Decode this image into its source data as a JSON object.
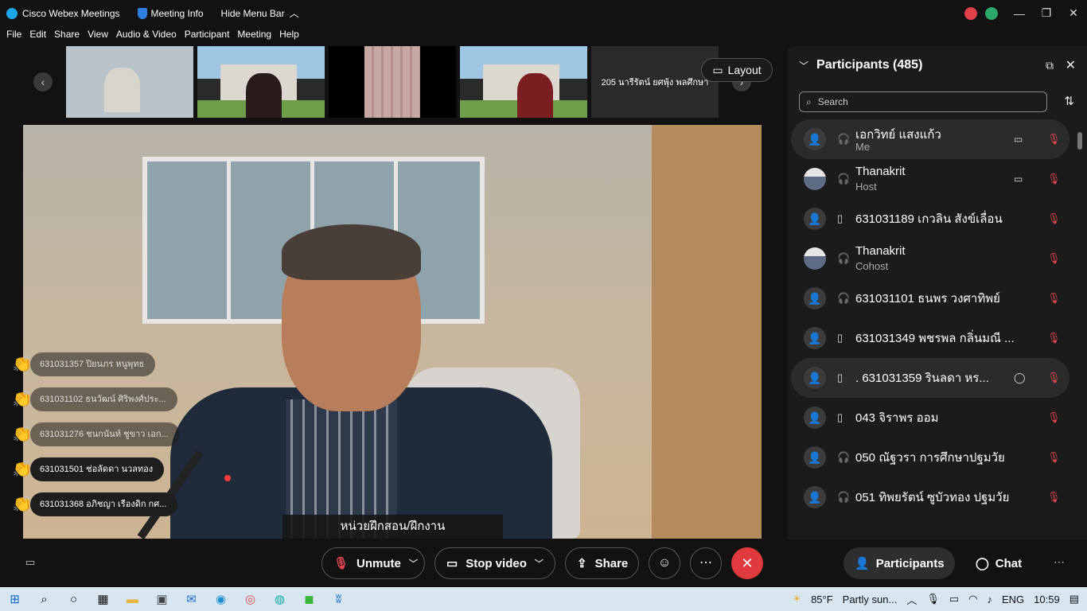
{
  "titlebar": {
    "app_name": "Cisco Webex Meetings",
    "meeting_info": "Meeting Info",
    "hide_menu_bar": "Hide Menu Bar"
  },
  "menu": [
    "File",
    "Edit",
    "Share",
    "View",
    "Audio & Video",
    "Participant",
    "Meeting",
    "Help"
  ],
  "filmstrip": {
    "name_card": "205 นารีรัตน์ ยศพุ้ง พลศึกษา",
    "layout_label": "Layout"
  },
  "main_video": {
    "caption": "หน่วยฝึกสอน/ฝึกงาน"
  },
  "reactions": [
    {
      "name": "631031357 ปิยนภร หนูพุทธ",
      "faded": true
    },
    {
      "name": "631031102 ธนวัฒน์ ศิริพงศ์ประ...",
      "faded": true
    },
    {
      "name": "631031276 ชนกนันท์ ชูขาว เอก...",
      "faded": true
    },
    {
      "name": "631031501 ช่อลัดดา นวลทอง",
      "faded": false
    },
    {
      "name": "631031368 อภิชญา เรืองดิก กศ...",
      "faded": false
    }
  ],
  "panel": {
    "title": "Participants (485)",
    "search_placeholder": "Search",
    "participants": [
      {
        "name": "เอกวิทย์ แสงแก้ว",
        "role": "Me",
        "device": "headset",
        "camera": true,
        "highlight": true
      },
      {
        "name": "Thanakrit",
        "role": "Host",
        "device": "headset",
        "camera": true,
        "highlight": false,
        "photo": true
      },
      {
        "name": "631031189 เกวลิน สังข์เลื่อน",
        "role": "",
        "device": "phone",
        "camera": false,
        "highlight": false
      },
      {
        "name": "Thanakrit",
        "role": "Cohost",
        "device": "headset",
        "camera": false,
        "highlight": false,
        "photo": true
      },
      {
        "name": "631031101 ธนพร วงศาทิพย์",
        "role": "",
        "device": "headset",
        "camera": false,
        "highlight": false
      },
      {
        "name": "631031349 พชรพล กลิ่นมณี ...",
        "role": "",
        "device": "phone",
        "camera": false,
        "highlight": false
      },
      {
        "name": ". 631031359 รินลดา หร...",
        "role": "",
        "device": "phone",
        "camera": false,
        "chat": true,
        "highlight": true
      },
      {
        "name": "043 จิราพร ออม",
        "role": "",
        "device": "phone",
        "camera": false,
        "highlight": false
      },
      {
        "name": "050 ณัฐวรา การศึกษาปฐมวัย",
        "role": "",
        "device": "headset",
        "camera": false,
        "highlight": false
      },
      {
        "name": "051 ทิพยรัตน์ ซูบัวทอง ปฐมวัย",
        "role": "",
        "device": "headset",
        "camera": false,
        "highlight": false
      }
    ]
  },
  "controls": {
    "unmute": "Unmute",
    "stop_video": "Stop video",
    "share": "Share",
    "participants": "Participants",
    "chat": "Chat"
  },
  "taskbar": {
    "weather": "85°F",
    "weather_desc": "Partly sun...",
    "lang": "ENG",
    "time": "10:59"
  }
}
